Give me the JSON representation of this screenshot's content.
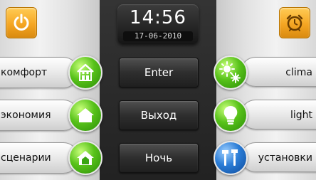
{
  "clock": {
    "time": "14:56",
    "date": "17-06-2010"
  },
  "left_menu": [
    {
      "label": "комфорт"
    },
    {
      "label": "экономия"
    },
    {
      "label": "сценарии"
    }
  ],
  "right_menu": [
    {
      "label": "clima"
    },
    {
      "label": "light"
    },
    {
      "label": "установки"
    }
  ],
  "center_buttons": [
    {
      "label": "Enter"
    },
    {
      "label": "Выход"
    },
    {
      "label": "Ночь"
    }
  ],
  "icons": {
    "power": "power-icon",
    "alarm": "alarm-clock-icon",
    "comfort": "family-house-icon",
    "economy": "house-icon",
    "scenarios": "house-outline-icon",
    "clima": "sun-snowflake-icon",
    "light": "light-bulb-icon",
    "settings": "tools-icon"
  },
  "colors": {
    "orange": "#f5a623",
    "green": "#58c21a",
    "blue": "#2a7cd6"
  }
}
